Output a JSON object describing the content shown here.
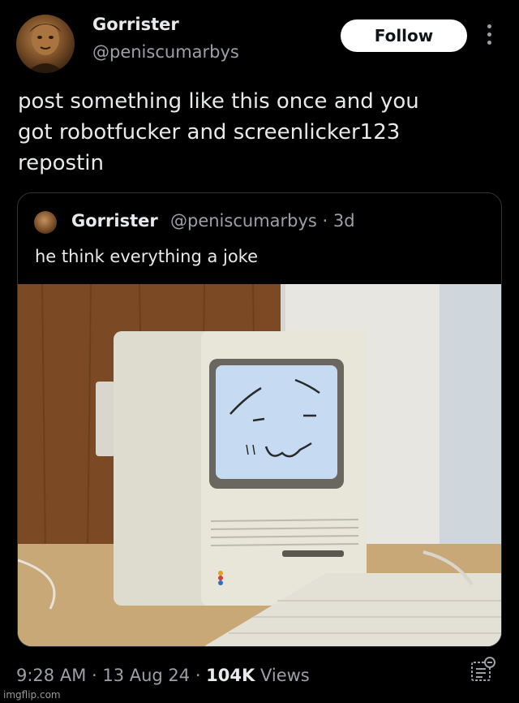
{
  "author": {
    "name": "Gorrister",
    "handle": "@peniscumarbys",
    "avatar_icon": "portrait-avatar"
  },
  "follow_label": "Follow",
  "post": {
    "text_lines": [
      "post something like this once and you",
      "got robotfucker and screenlicker123",
      "repostin"
    ]
  },
  "quote": {
    "name": "Gorrister",
    "meta": "@peniscumarbys · 3d",
    "text": "he think everything a joke",
    "image_icon": "vintage-computer-smiling-face-photo"
  },
  "footer": {
    "time_date": "9:28 AM · 13 Aug 24 · ",
    "views_count": "104K",
    "views_label": " Views",
    "analytics_icon": "analytics-icon"
  },
  "watermark": "imgflip.com",
  "colors": {
    "background": "#000000",
    "text": "#e7e9ea",
    "muted": "#9aa0a6",
    "border": "#2f3336",
    "button_bg": "#ffffff"
  }
}
